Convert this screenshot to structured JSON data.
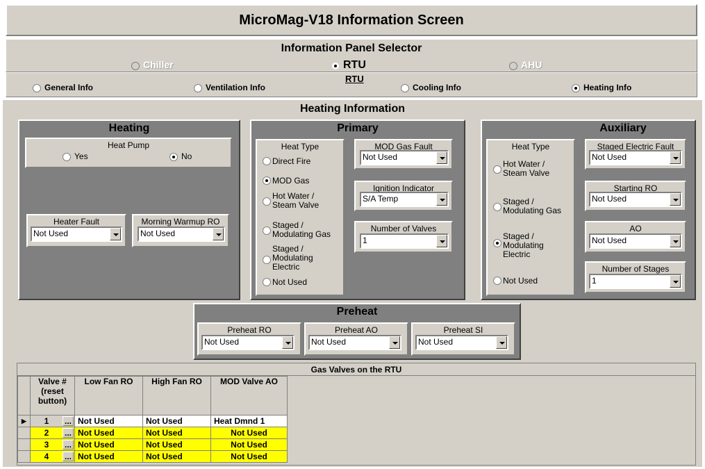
{
  "title": "MicroMag-V18 Information Screen",
  "selector": {
    "heading": "Information Panel Selector",
    "options": [
      "Chiller",
      "RTU",
      "AHU"
    ],
    "selected": "RTU"
  },
  "rtu_label": "RTU",
  "info_tabs": {
    "general": "General Info",
    "ventilation": "Ventilation Info",
    "cooling": "Cooling Info",
    "heating": "Heating Info"
  },
  "section_title": "Heating Information",
  "heating": {
    "title": "Heating",
    "heat_pump_label": "Heat Pump",
    "yes": "Yes",
    "no": "No",
    "heater_fault_label": "Heater Fault",
    "heater_fault_value": "Not Used",
    "morning_warmup_label": "Morning Warmup RO",
    "morning_warmup_value": "Not Used"
  },
  "primary": {
    "title": "Primary",
    "heat_type_label": "Heat Type",
    "heat_types": [
      "Direct Fire",
      "MOD Gas",
      "Hot Water / Steam Valve",
      "Staged / Modulating Gas",
      "Staged / Modulating Electric",
      "Not Used"
    ],
    "mod_gas_fault_label": "MOD Gas Fault",
    "mod_gas_fault_value": "Not Used",
    "ignition_label": "Ignition Indicator",
    "ignition_value": "S/A Temp",
    "valves_label": "Number of Valves",
    "valves_value": "1"
  },
  "auxiliary": {
    "title": "Auxiliary",
    "heat_type_label": "Heat Type",
    "heat_types": [
      "Hot Water / Steam Valve",
      "Staged / Modulating Gas",
      "Staged / Modulating Electric",
      "Not Used"
    ],
    "staged_fault_label": "Staged Electric Fault",
    "staged_fault_value": "Not Used",
    "starting_ro_label": "Starting RO",
    "starting_ro_value": "Not Used",
    "ao_label": "AO",
    "ao_value": "Not Used",
    "stages_label": "Number of Stages",
    "stages_value": "1"
  },
  "preheat": {
    "title": "Preheat",
    "ro_label": "Preheat RO",
    "ro_value": "Not Used",
    "ao_label": "Preheat AO",
    "ao_value": "Not Used",
    "si_label": "Preheat SI",
    "si_value": "Not Used"
  },
  "gas_valves": {
    "title": "Gas Valves on the RTU",
    "headers": [
      "Valve # (reset button)",
      "Low Fan RO",
      "High Fan RO",
      "MOD Valve AO"
    ],
    "ellipsis": "...",
    "rows": [
      {
        "num": "1",
        "low": "Not Used",
        "high": "Not Used",
        "mod": "Heat Dmnd 1"
      },
      {
        "num": "2",
        "low": "Not Used",
        "high": "Not Used",
        "mod": "Not Used"
      },
      {
        "num": "3",
        "low": "Not Used",
        "high": "Not Used",
        "mod": "Not Used"
      },
      {
        "num": "4",
        "low": "Not Used",
        "high": "Not Used",
        "mod": "Not Used"
      }
    ]
  },
  "colors": {
    "panel": "#d4d0c8",
    "header": "#808080",
    "highlight": "#ffff00"
  }
}
